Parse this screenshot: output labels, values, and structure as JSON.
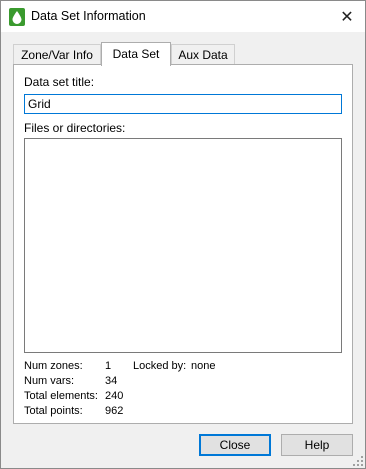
{
  "window": {
    "title": "Data Set Information",
    "close_glyph": "✕",
    "icon": "droplet-app-icon"
  },
  "tabs": [
    {
      "label": "Zone/Var Info",
      "active": false
    },
    {
      "label": "Data Set",
      "active": true
    },
    {
      "label": "Aux Data",
      "active": false
    }
  ],
  "dataset": {
    "title_label": "Data set title:",
    "title_value": "Grid",
    "files_label": "Files or directories:",
    "files": []
  },
  "stats": {
    "num_zones_label": "Num zones:",
    "num_zones": "1",
    "locked_label": "Locked by:",
    "locked_value": "none",
    "num_vars_label": "Num vars:",
    "num_vars": "34",
    "total_elements_label": "Total elements:",
    "total_elements": "240",
    "total_points_label": "Total points:",
    "total_points": "962"
  },
  "buttons": {
    "close": "Close",
    "help": "Help"
  },
  "colors": {
    "focus_blue": "#0078d7",
    "app_icon_green": "#3a9a2e"
  }
}
